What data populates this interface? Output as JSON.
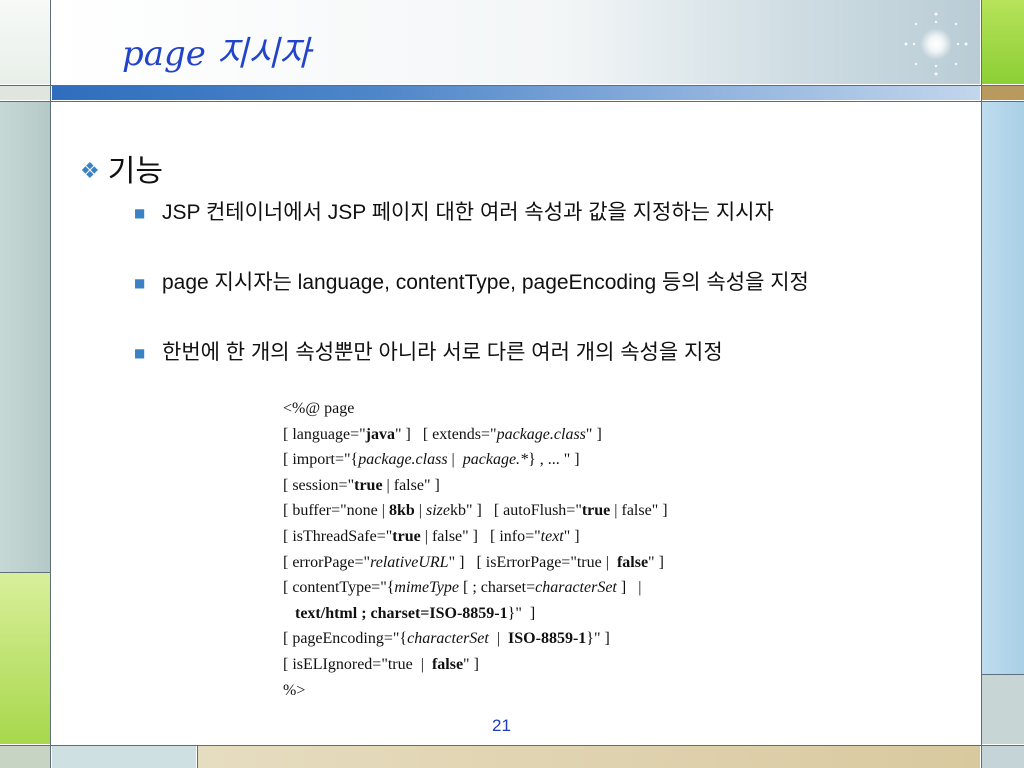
{
  "slide": {
    "title": "page 지시자",
    "heading": "기능",
    "bullets": [
      "JSP 컨테이너에서 JSP 페이지 대한 여러 속성과 값을 지정하는 지시자",
      "page 지시자는 language, contentType, pageEncoding 등의 속성을 지정",
      "한번에 한 개의 속성뿐만 아니라 서로 다른 여러 개의 속성을 지정"
    ],
    "syntax_lines": [
      [
        [
          "n",
          "<%@ page"
        ]
      ],
      [
        [
          "n",
          "[ language=\""
        ],
        [
          "b",
          "java"
        ],
        [
          "n",
          "\" ]   [ extends=\""
        ],
        [
          "i",
          "package.class"
        ],
        [
          "n",
          "\" ]"
        ]
      ],
      [
        [
          "n",
          "[ import=\"{"
        ],
        [
          "i",
          "package.class"
        ],
        [
          "n",
          " |  "
        ],
        [
          "i",
          "package.*"
        ],
        [
          "n",
          "} , ... \" ]"
        ]
      ],
      [
        [
          "n",
          "[ session=\""
        ],
        [
          "b",
          "true"
        ],
        [
          "n",
          " | false\" ]"
        ]
      ],
      [
        [
          "n",
          "[ buffer=\"none | "
        ],
        [
          "b",
          "8kb"
        ],
        [
          "n",
          " | "
        ],
        [
          "i",
          "size"
        ],
        [
          "n",
          "kb\" ]   [ autoFlush=\""
        ],
        [
          "b",
          "true"
        ],
        [
          "n",
          " | false\" ]"
        ]
      ],
      [
        [
          "n",
          "[ isThreadSafe=\""
        ],
        [
          "b",
          "true"
        ],
        [
          "n",
          " | false\" ]   [ info=\""
        ],
        [
          "i",
          "text"
        ],
        [
          "n",
          "\" ]"
        ]
      ],
      [
        [
          "n",
          "[ errorPage=\""
        ],
        [
          "i",
          "relativeURL"
        ],
        [
          "n",
          "\" ]   [ isErrorPage=\"true |  "
        ],
        [
          "b",
          "false"
        ],
        [
          "n",
          "\" ]"
        ]
      ],
      [
        [
          "n",
          "[ contentType=\"{"
        ],
        [
          "i",
          "mimeType"
        ],
        [
          "n",
          " [ ; charset="
        ],
        [
          "i",
          "characterSet"
        ],
        [
          "n",
          " ]   |"
        ]
      ],
      [
        [
          "n",
          "   "
        ],
        [
          "b",
          "text/html ; charset=ISO-8859-1"
        ],
        [
          "n",
          "}\"  ]"
        ]
      ],
      [
        [
          "n",
          "[ pageEncoding=\"{"
        ],
        [
          "i",
          "characterSet"
        ],
        [
          "n",
          "  |  "
        ],
        [
          "b",
          "ISO-8859-1"
        ],
        [
          "n",
          "}\" ]"
        ]
      ],
      [
        [
          "n",
          "[ isELIgnored=\"true  |  "
        ],
        [
          "b",
          "false"
        ],
        [
          "n",
          "\" ]"
        ]
      ],
      [
        [
          "n",
          "%>"
        ]
      ]
    ],
    "page_number": "21"
  },
  "colors": {
    "title": "#2244c8",
    "bullet": "#3a82c4",
    "stripe": "#2f6ebd",
    "accent_green": "#8ccf35",
    "accent_blue": "#a9cfe6"
  },
  "icons": {
    "heading_marker": "diamond-cluster-icon",
    "bullet_marker": "square-bullet-icon",
    "decoration": "sparkle-icon"
  }
}
